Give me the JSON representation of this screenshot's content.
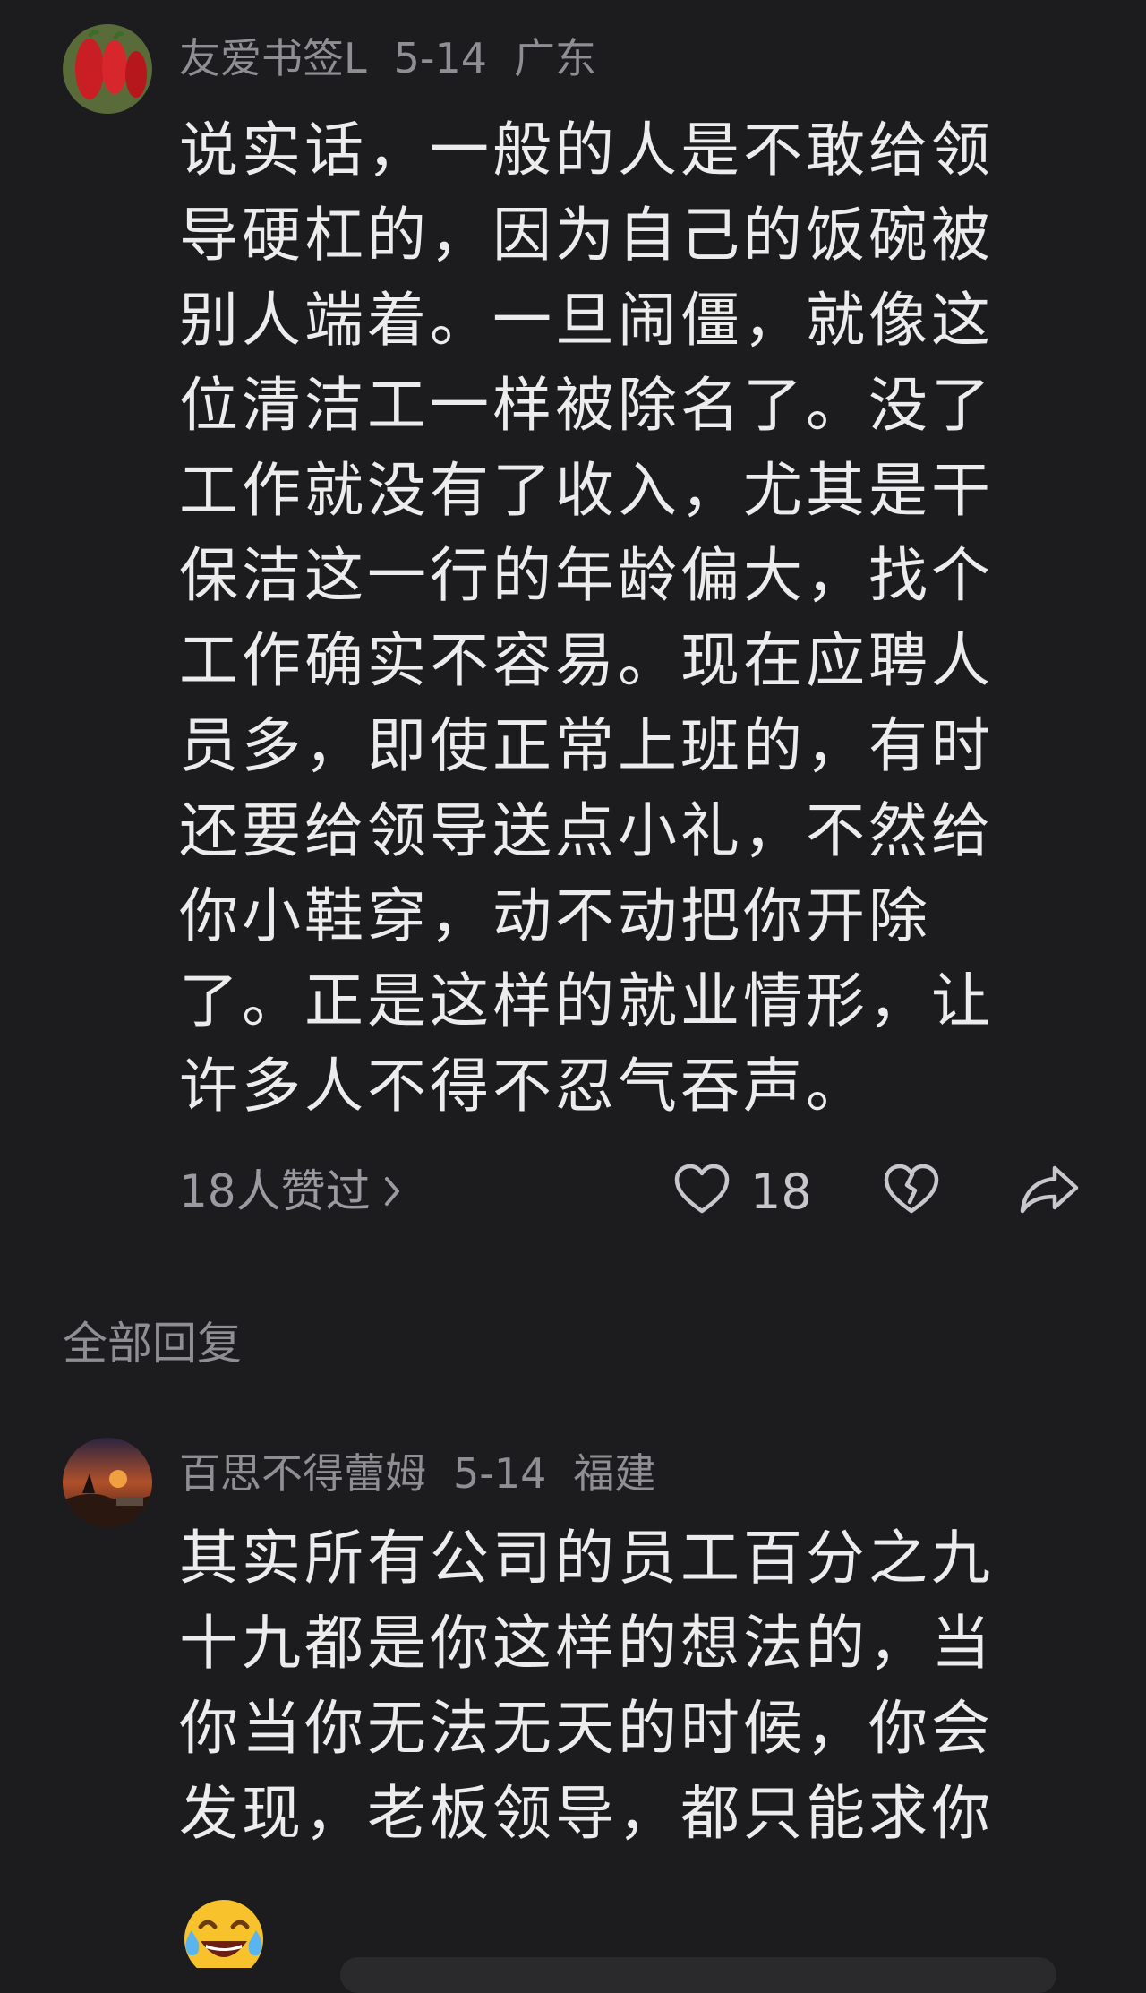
{
  "comment": {
    "username": "友爱书签L",
    "date": "5-14",
    "location": "广东",
    "lines": [
      "说实话，一般的人是不敢给领",
      "导硬杠的，因为自己的饭碗被",
      "别人端着。一旦闹僵，就像这",
      "位清洁工一样被除名了。没了",
      "工作就没有了收入，尤其是干",
      "保洁这一行的年龄偏大，找个",
      "工作确实不容易。现在应聘人",
      "员多，即使正常上班的，有时",
      "还要给领导送点小礼，不然给",
      "你小鞋穿，动不动把你开除",
      "了。正是这样的就业情形，让",
      "许多人不得不忍气吞声。"
    ],
    "liked_by_text": "18人赞过",
    "like_count": "18"
  },
  "replies_section": {
    "label": "全部回复"
  },
  "reply": {
    "username": "百思不得蕾姆",
    "date": "5-14",
    "location": "福建",
    "lines": [
      "其实所有公司的员工百分之九",
      "十九都是你这样的想法的，当",
      "你当你无法无天的时候，你会",
      "发现，老板领导，都只能求你"
    ],
    "emoji": "tears-of-joy"
  },
  "icons": {
    "like": "heart-icon",
    "dislike": "broken-heart-icon",
    "share": "share-arrow-icon",
    "chevron": "chevron-right-icon"
  },
  "colors": {
    "background": "#1c1c1e",
    "text": "#ececec",
    "meta": "#8e8e93"
  }
}
